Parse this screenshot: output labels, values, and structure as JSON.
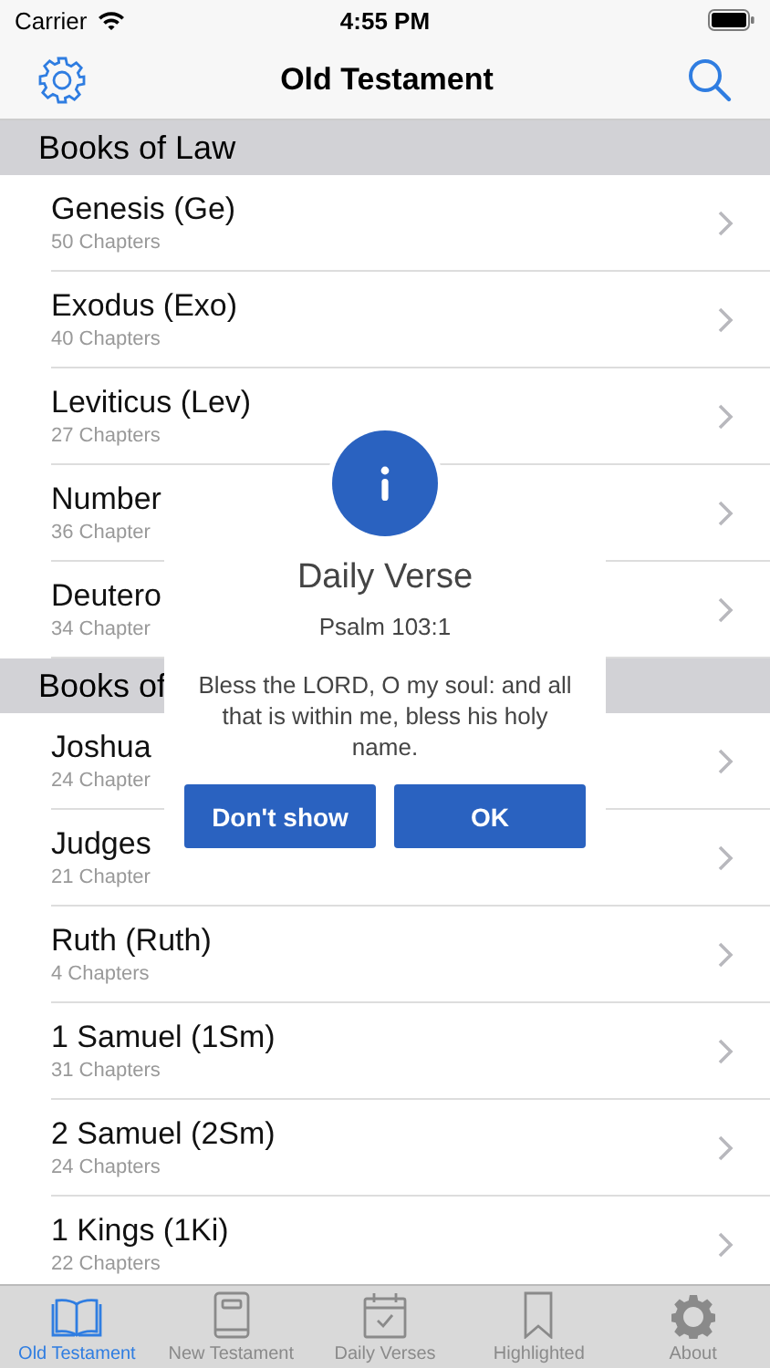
{
  "status_bar": {
    "carrier": "Carrier",
    "time": "4:55 PM"
  },
  "nav": {
    "title": "Old Testament"
  },
  "sections": [
    {
      "title": "Books of Law",
      "rows": [
        {
          "name": "Genesis (Ge)",
          "chapters": "50 Chapters"
        },
        {
          "name": "Exodus (Exo)",
          "chapters": "40 Chapters"
        },
        {
          "name": "Leviticus (Lev)",
          "chapters": "27 Chapters"
        },
        {
          "name": "Number",
          "chapters": "36 Chapter"
        },
        {
          "name": "Deutero",
          "chapters": "34 Chapter"
        }
      ]
    },
    {
      "title": "Books of",
      "rows": [
        {
          "name": "Joshua",
          "chapters": "24 Chapter"
        },
        {
          "name": "Judges",
          "chapters": "21 Chapter"
        },
        {
          "name": "Ruth (Ruth)",
          "chapters": "4 Chapters"
        },
        {
          "name": "1 Samuel (1Sm)",
          "chapters": "31 Chapters"
        },
        {
          "name": "2 Samuel (2Sm)",
          "chapters": "24 Chapters"
        },
        {
          "name": "1 Kings (1Ki)",
          "chapters": "22 Chapters"
        }
      ]
    }
  ],
  "dialog": {
    "title": "Daily Verse",
    "reference": "Psalm 103:1",
    "verse": "Bless the LORD, O my soul: and all that is within me, bless his holy name.",
    "buttons": [
      "Don't show",
      "OK"
    ]
  },
  "tab_bar": [
    {
      "label": "Old Testament",
      "kind": "book",
      "selected": true
    },
    {
      "label": "New Testament",
      "kind": "bible",
      "selected": false
    },
    {
      "label": "Daily Verses",
      "kind": "calendar",
      "selected": false
    },
    {
      "label": "Highlighted",
      "kind": "bookmark",
      "selected": false
    },
    {
      "label": "About",
      "kind": "gear",
      "selected": false
    }
  ]
}
